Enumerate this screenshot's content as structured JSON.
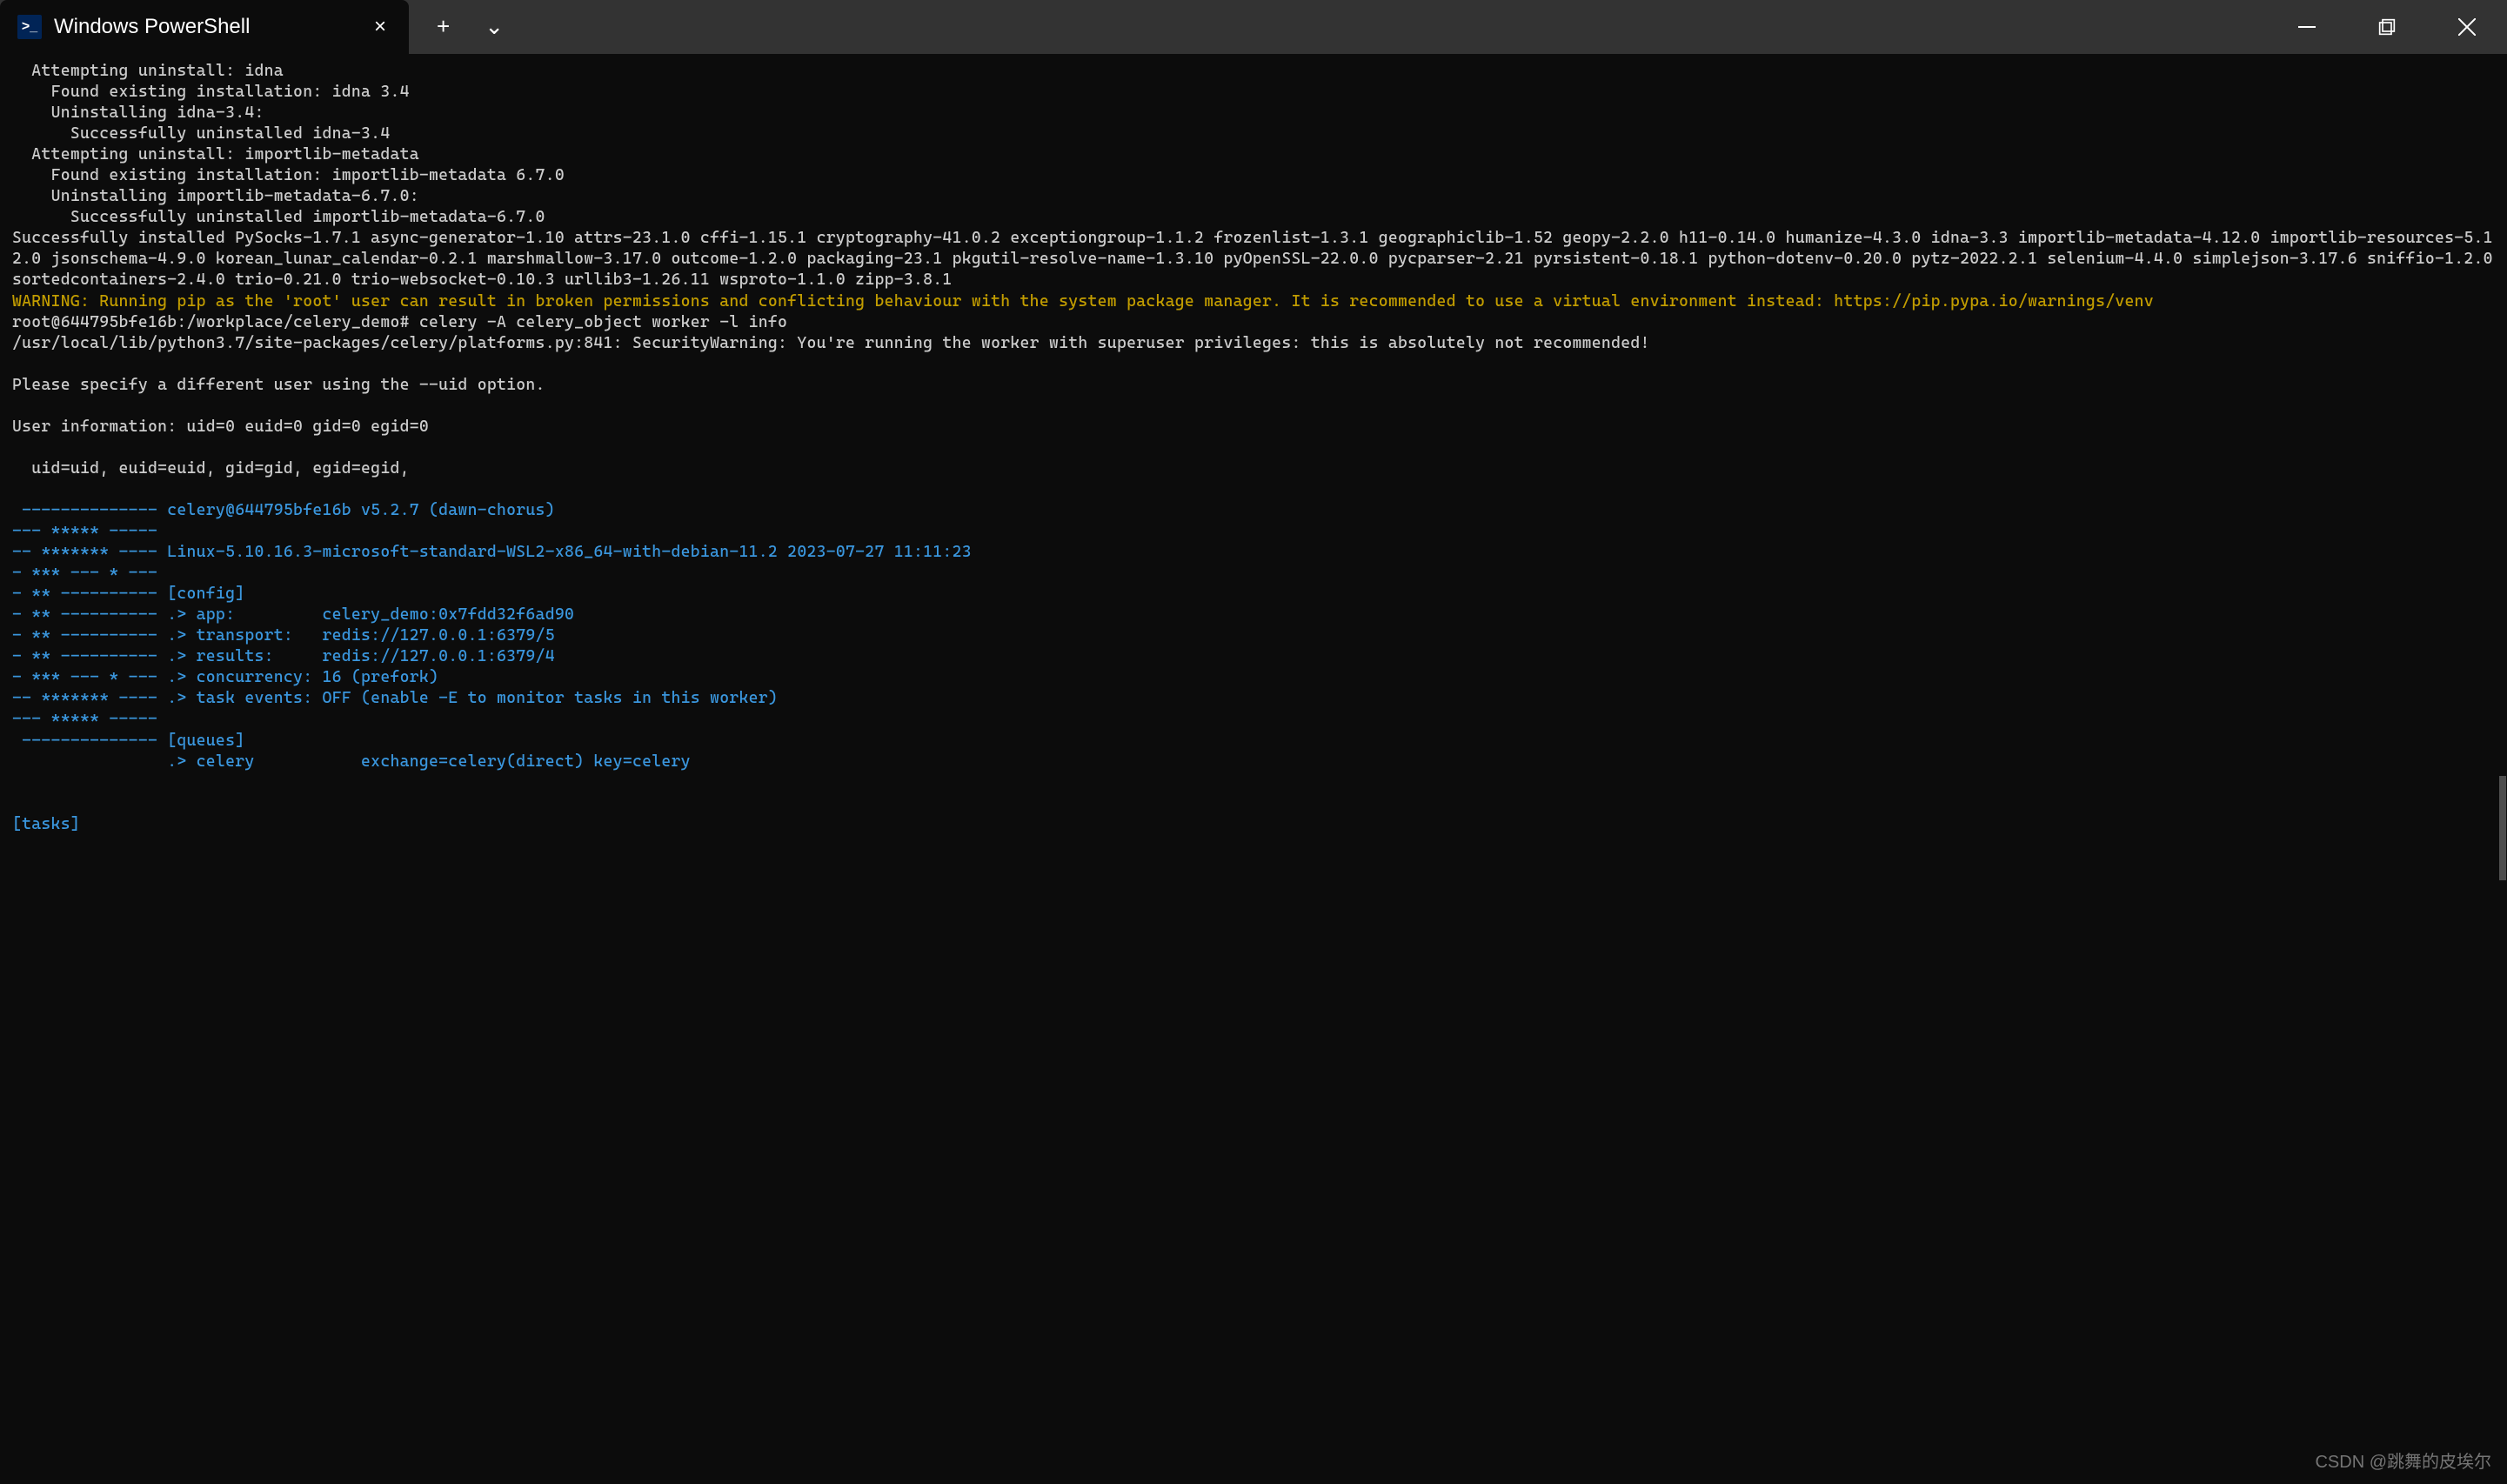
{
  "titlebar": {
    "tab_title": "Windows PowerShell",
    "tab_close": "×",
    "tab_add": "+",
    "tab_dropdown": "⌄"
  },
  "terminal": {
    "lines": [
      {
        "cls": "white",
        "text": "  Attempting uninstall: idna"
      },
      {
        "cls": "white",
        "text": "    Found existing installation: idna 3.4"
      },
      {
        "cls": "white",
        "text": "    Uninstalling idna-3.4:"
      },
      {
        "cls": "white",
        "text": "      Successfully uninstalled idna-3.4"
      },
      {
        "cls": "white",
        "text": "  Attempting uninstall: importlib-metadata"
      },
      {
        "cls": "white",
        "text": "    Found existing installation: importlib-metadata 6.7.0"
      },
      {
        "cls": "white",
        "text": "    Uninstalling importlib-metadata-6.7.0:"
      },
      {
        "cls": "white",
        "text": "      Successfully uninstalled importlib-metadata-6.7.0"
      },
      {
        "cls": "white",
        "text": "Successfully installed PySocks-1.7.1 async-generator-1.10 attrs-23.1.0 cffi-1.15.1 cryptography-41.0.2 exceptiongroup-1.1.2 frozenlist-1.3.1 geographiclib-1.52 geopy-2.2.0 h11-0.14.0 humanize-4.3.0 idna-3.3 importlib-metadata-4.12.0 importlib-resources-5.12.0 jsonschema-4.9.0 korean_lunar_calendar-0.2.1 marshmallow-3.17.0 outcome-1.2.0 packaging-23.1 pkgutil-resolve-name-1.3.10 pyOpenSSL-22.0.0 pycparser-2.21 pyrsistent-0.18.1 python-dotenv-0.20.0 pytz-2022.2.1 selenium-4.4.0 simplejson-3.17.6 sniffio-1.2.0 sortedcontainers-2.4.0 trio-0.21.0 trio-websocket-0.10.3 urllib3-1.26.11 wsproto-1.1.0 zipp-3.8.1"
      },
      {
        "cls": "yellow",
        "text": "WARNING: Running pip as the 'root' user can result in broken permissions and conflicting behaviour with the system package manager. It is recommended to use a virtual environment instead: https://pip.pypa.io/warnings/venv"
      },
      {
        "cls": "white",
        "text": "root@644795bfe16b:/workplace/celery_demo# celery -A celery_object worker -l info"
      },
      {
        "cls": "white",
        "text": "/usr/local/lib/python3.7/site-packages/celery/platforms.py:841: SecurityWarning: You're running the worker with superuser privileges: this is absolutely not recommended!"
      },
      {
        "cls": "white",
        "text": ""
      },
      {
        "cls": "white",
        "text": "Please specify a different user using the --uid option."
      },
      {
        "cls": "white",
        "text": ""
      },
      {
        "cls": "white",
        "text": "User information: uid=0 euid=0 gid=0 egid=0"
      },
      {
        "cls": "white",
        "text": ""
      },
      {
        "cls": "white",
        "text": "  uid=uid, euid=euid, gid=gid, egid=egid,"
      },
      {
        "cls": "white",
        "text": ""
      },
      {
        "cls": "cyan",
        "text": " -------------- celery@644795bfe16b v5.2.7 (dawn-chorus)"
      },
      {
        "cls": "cyan",
        "text": "--- ***** -----"
      },
      {
        "cls": "cyan",
        "text": "-- ******* ---- Linux-5.10.16.3-microsoft-standard-WSL2-x86_64-with-debian-11.2 2023-07-27 11:11:23"
      },
      {
        "cls": "cyan",
        "text": "- *** --- * ---"
      },
      {
        "cls": "cyan",
        "text": "- ** ---------- [config]"
      },
      {
        "cls": "cyan",
        "text": "- ** ---------- .> app:         celery_demo:0x7fdd32f6ad90"
      },
      {
        "cls": "cyan",
        "text": "- ** ---------- .> transport:   redis://127.0.0.1:6379/5"
      },
      {
        "cls": "cyan",
        "text": "- ** ---------- .> results:     redis://127.0.0.1:6379/4"
      },
      {
        "cls": "cyan",
        "text": "- *** --- * --- .> concurrency: 16 (prefork)"
      },
      {
        "cls": "cyan",
        "text": "-- ******* ---- .> task events: OFF (enable -E to monitor tasks in this worker)"
      },
      {
        "cls": "cyan",
        "text": "--- ***** -----"
      },
      {
        "cls": "cyan",
        "text": " -------------- [queues]"
      },
      {
        "cls": "cyan",
        "text": "                .> celery           exchange=celery(direct) key=celery"
      },
      {
        "cls": "cyan",
        "text": ""
      },
      {
        "cls": "cyan",
        "text": ""
      },
      {
        "cls": "cyan",
        "text": "[tasks]"
      }
    ]
  },
  "watermark": "CSDN @跳舞的皮埃尔"
}
